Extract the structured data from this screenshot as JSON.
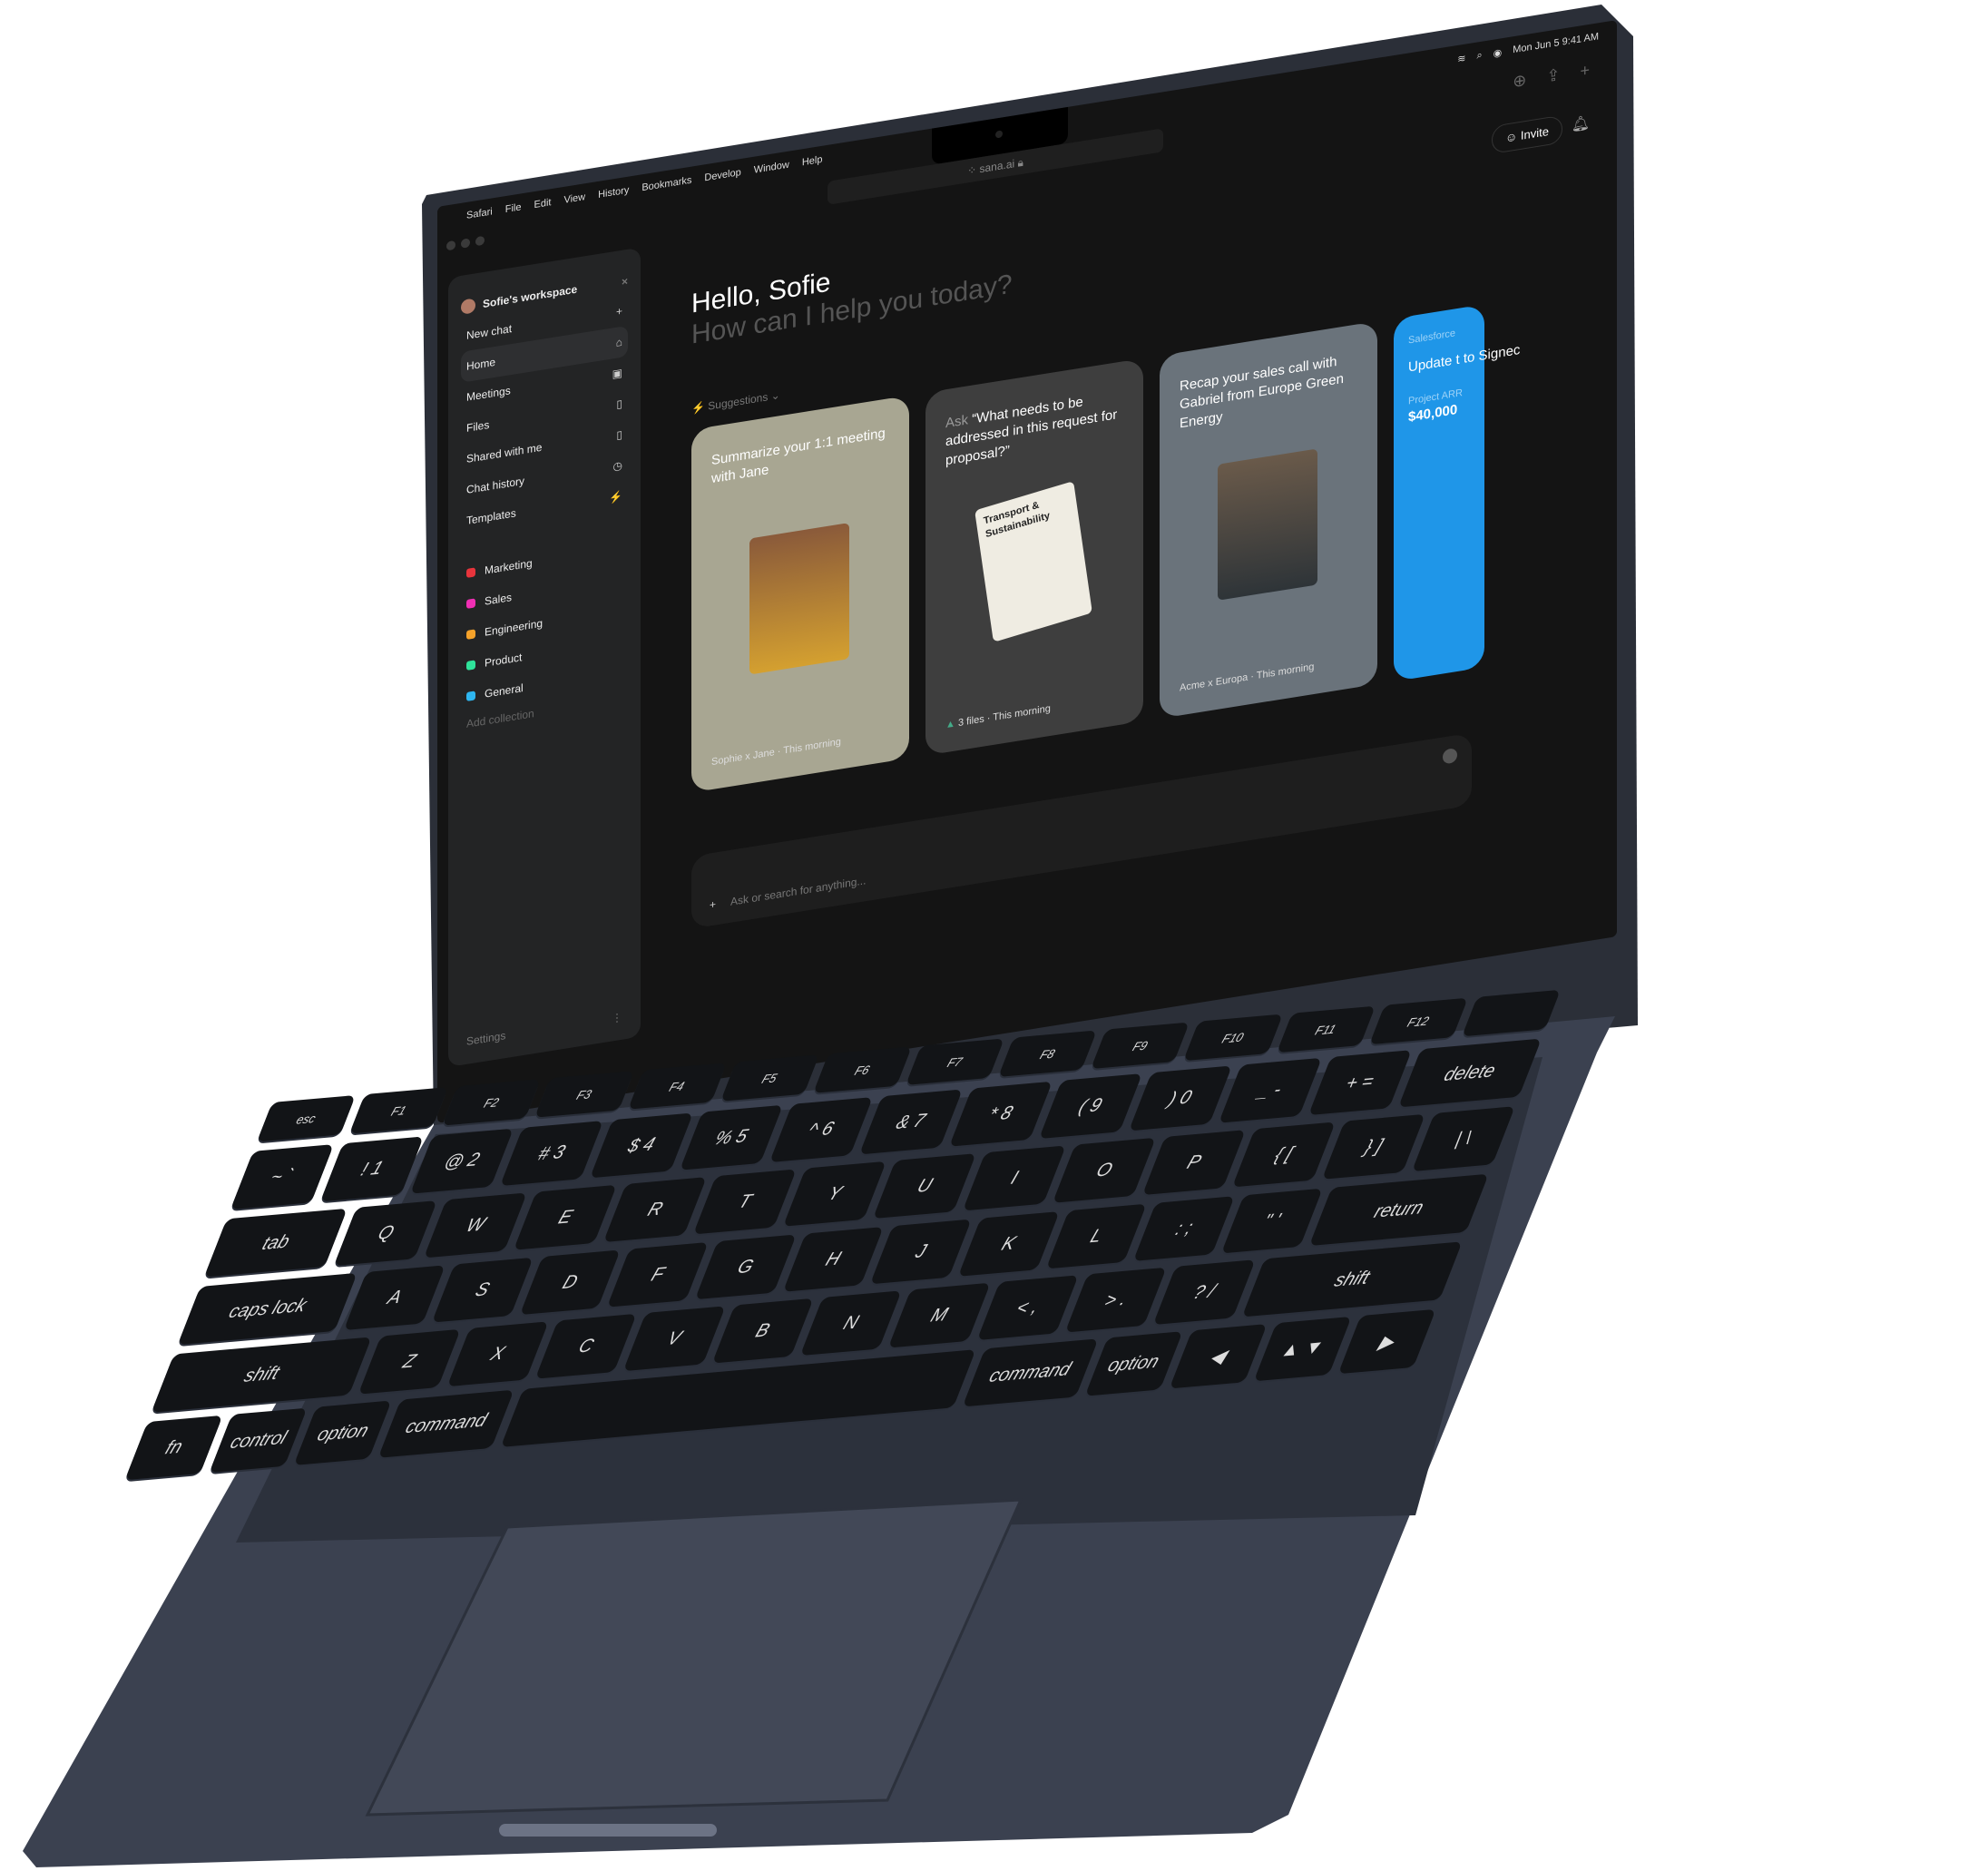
{
  "menubar": {
    "apple": "",
    "items": [
      "Safari",
      "File",
      "Edit",
      "View",
      "History",
      "Bookmarks",
      "Develop",
      "Window",
      "Help"
    ],
    "datetime": "Mon Jun 5  9:41 AM"
  },
  "browser": {
    "url": "sana.ai",
    "invite": "Invite"
  },
  "sidebar": {
    "workspace": "Sofie's workspace",
    "new_chat": "New chat",
    "nav": [
      {
        "label": "Home",
        "icon": "home-icon",
        "glyph": "⌂"
      },
      {
        "label": "Meetings",
        "icon": "video-icon",
        "glyph": "▣"
      },
      {
        "label": "Files",
        "icon": "file-icon",
        "glyph": "▯"
      },
      {
        "label": "Shared with me",
        "icon": "shared-file-icon",
        "glyph": "▯"
      },
      {
        "label": "Chat history",
        "icon": "history-icon",
        "glyph": "◷"
      },
      {
        "label": "Templates",
        "icon": "template-icon",
        "glyph": "⚡"
      }
    ],
    "collections": [
      {
        "label": "Marketing",
        "color": "#e8343c"
      },
      {
        "label": "Sales",
        "color": "#f02fb4"
      },
      {
        "label": "Engineering",
        "color": "#f5a22a"
      },
      {
        "label": "Product",
        "color": "#2fe39a"
      },
      {
        "label": "General",
        "color": "#2eb6f0"
      }
    ],
    "add_collection": "Add collection",
    "settings": "Settings"
  },
  "main": {
    "greeting": "Hello, Sofie",
    "subtitle": "How can I help you today?",
    "suggestions_label": "Suggestions",
    "cards": [
      {
        "title": "Summarize your 1:1 meeting with Jane",
        "meta": "Sophie x Jane  ·  This morning",
        "bg": "#a8a692"
      },
      {
        "prefix": "Ask",
        "title": "“What needs to be addressed in this request for proposal?”",
        "doc_title": "Transport & Sustainability",
        "meta": "3 files  ·  This morning",
        "bg": "#3e3e3e"
      },
      {
        "title": "Recap your sales call with Gabriel from Europe Green Energy",
        "meta": "Acme x Europa  ·  This morning",
        "bg": "#6a737b"
      },
      {
        "source": "Salesforce",
        "title": "Update t to Signec",
        "field": "Project ARR",
        "value": "$40,000",
        "bg": "#1f96e8"
      }
    ],
    "composer_placeholder": "Ask or search for anything..."
  },
  "keyboard": {
    "rows": [
      [
        "esc",
        "F1",
        "F2",
        "F3",
        "F4",
        "F5",
        "F6",
        "F7",
        "F8",
        "F9",
        "F10",
        "F11",
        "F12",
        ""
      ],
      [
        "~ `",
        "! 1",
        "@ 2",
        "# 3",
        "$ 4",
        "% 5",
        "^ 6",
        "& 7",
        "* 8",
        "( 9",
        ") 0",
        "_ -",
        "+ =",
        "delete"
      ],
      [
        "tab",
        "Q",
        "W",
        "E",
        "R",
        "T",
        "Y",
        "U",
        "I",
        "O",
        "P",
        "{ [",
        "} ]",
        "| \\"
      ],
      [
        "caps lock",
        "A",
        "S",
        "D",
        "F",
        "G",
        "H",
        "J",
        "K",
        "L",
        ": ;",
        "\" '",
        "return"
      ],
      [
        "shift",
        "Z",
        "X",
        "C",
        "V",
        "B",
        "N",
        "M",
        "< ,",
        "> .",
        "? /",
        "shift"
      ],
      [
        "fn",
        "control",
        "option",
        "command",
        "",
        "command",
        "option",
        "◀",
        "▲ ▼",
        "▶"
      ]
    ]
  }
}
